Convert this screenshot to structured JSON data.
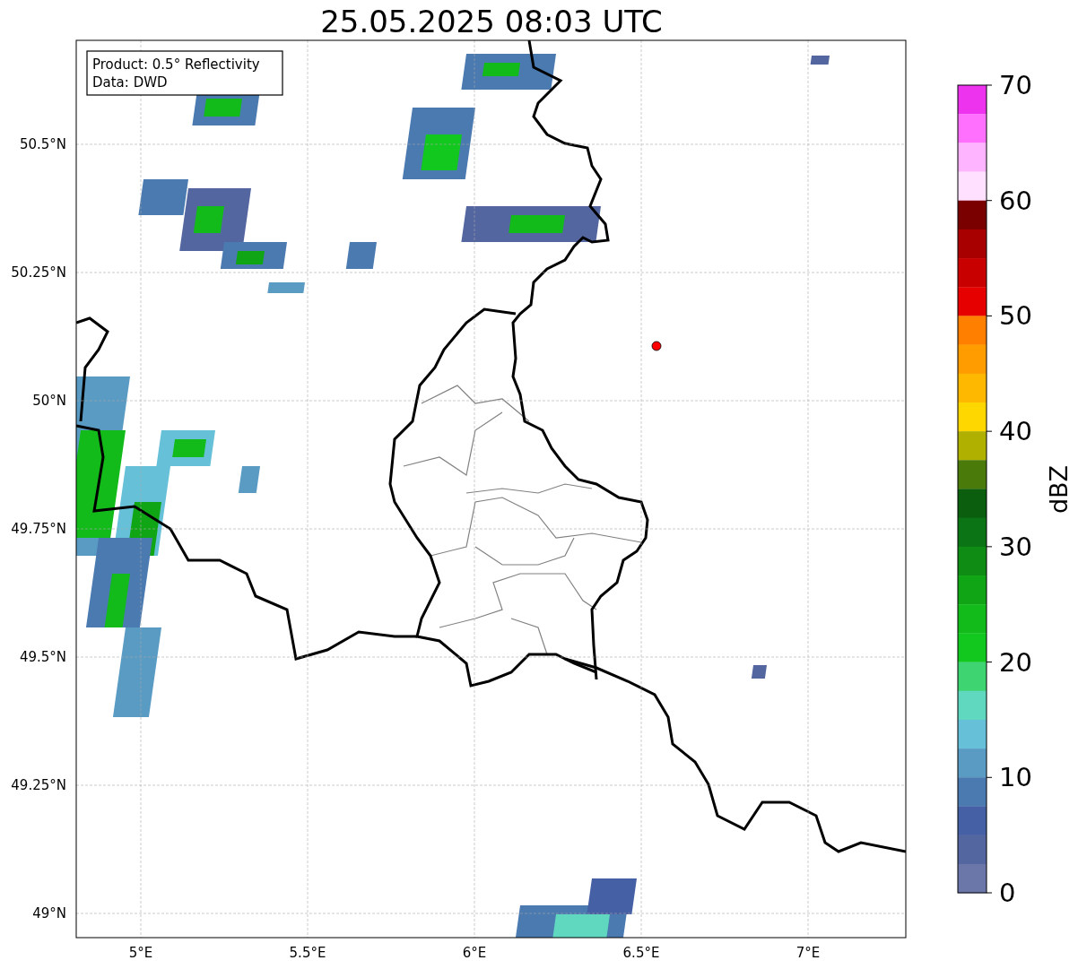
{
  "title": "25.05.2025 08:03 UTC",
  "info_box": {
    "lines": [
      "Product: 0.5° Reflectivity",
      "Data: DWD"
    ]
  },
  "x_ticks": [
    "5°E",
    "5.5°E",
    "6°E",
    "6.5°E",
    "7°E"
  ],
  "y_ticks": [
    "50.5°N",
    "50.25°N",
    "50°N",
    "49.75°N",
    "49.5°N",
    "49.25°N",
    "49°N"
  ],
  "colorbar": {
    "label": "dBZ",
    "ticks": [
      "70",
      "60",
      "50",
      "40",
      "30",
      "20",
      "10",
      "0"
    ],
    "segments": [
      {
        "color": "#ee33ee"
      },
      {
        "color": "#ff70ff"
      },
      {
        "color": "#ffb4ff"
      },
      {
        "color": "#ffe0ff"
      },
      {
        "color": "#7a0000"
      },
      {
        "color": "#a80000"
      },
      {
        "color": "#c80000"
      },
      {
        "color": "#e60000"
      },
      {
        "color": "#ff7f00"
      },
      {
        "color": "#ff9c00"
      },
      {
        "color": "#ffb800"
      },
      {
        "color": "#ffd700"
      },
      {
        "color": "#b0b000"
      },
      {
        "color": "#4a7a0a"
      },
      {
        "color": "#0a5e0e"
      },
      {
        "color": "#0b7414"
      },
      {
        "color": "#0e8c14"
      },
      {
        "color": "#10a514"
      },
      {
        "color": "#12bb1a"
      },
      {
        "color": "#12c81e"
      },
      {
        "color": "#3ed472"
      },
      {
        "color": "#60d8c0"
      },
      {
        "color": "#66c0d8"
      },
      {
        "color": "#5a9bc4"
      },
      {
        "color": "#4a7ab0"
      },
      {
        "color": "#4560a4"
      },
      {
        "color": "#5366a0"
      },
      {
        "color": "#6a77a8"
      }
    ]
  }
}
